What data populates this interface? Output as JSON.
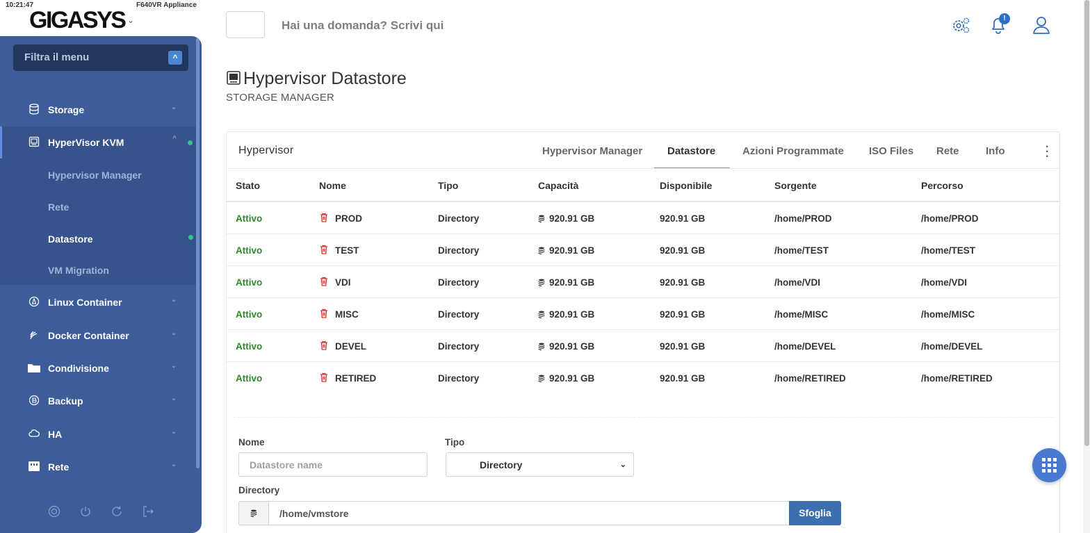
{
  "brand": {
    "clock": "10:21:47",
    "appliance": "F640VR Appliance",
    "logo_text": "GIGASYS"
  },
  "sidebar": {
    "filter_placeholder": "Filtra il menu",
    "items": [
      {
        "label": "Storage",
        "icon": "database-icon"
      },
      {
        "label": "HyperVisor KVM",
        "icon": "monitor-icon",
        "expanded": true
      },
      {
        "label": "Linux Container",
        "icon": "linux-icon"
      },
      {
        "label": "Docker Container",
        "icon": "docker-icon"
      },
      {
        "label": "Condivisione",
        "icon": "folder-icon"
      },
      {
        "label": "Backup",
        "icon": "backup-icon"
      },
      {
        "label": "HA",
        "icon": "cloud-icon"
      },
      {
        "label": "Rete",
        "icon": "network-icon"
      }
    ],
    "sub_items": [
      {
        "label": "Hypervisor Manager"
      },
      {
        "label": "Rete"
      },
      {
        "label": "Datastore",
        "active": true
      },
      {
        "label": "VM Migration"
      }
    ],
    "bottom_icons": [
      "lifebuoy-icon",
      "power-icon",
      "refresh-icon",
      "logout-icon"
    ]
  },
  "header": {
    "ask": "Hai una domanda? Scrivi qui",
    "notification_badge": "!"
  },
  "page": {
    "title": "Hypervisor Datastore",
    "subtitle": "STORAGE MANAGER"
  },
  "card": {
    "title": "Hypervisor",
    "tabs": [
      "Hypervisor Manager",
      "Datastore",
      "Azioni Programmate",
      "ISO Files",
      "Rete",
      "Info"
    ],
    "active_tab": "Datastore"
  },
  "table": {
    "headers": [
      "Stato",
      "Nome",
      "Tipo",
      "Capacità",
      "Disponibile",
      "Sorgente",
      "Percorso"
    ],
    "rows": [
      {
        "stato": "Attivo",
        "nome": "PROD",
        "tipo": "Directory",
        "capacita": "920.91 GB",
        "disponibile": "920.91 GB",
        "sorgente": "/home/PROD",
        "percorso": "/home/PROD"
      },
      {
        "stato": "Attivo",
        "nome": "TEST",
        "tipo": "Directory",
        "capacita": "920.91 GB",
        "disponibile": "920.91 GB",
        "sorgente": "/home/TEST",
        "percorso": "/home/TEST"
      },
      {
        "stato": "Attivo",
        "nome": "VDI",
        "tipo": "Directory",
        "capacita": "920.91 GB",
        "disponibile": "920.91 GB",
        "sorgente": "/home/VDI",
        "percorso": "/home/VDI"
      },
      {
        "stato": "Attivo",
        "nome": "MISC",
        "tipo": "Directory",
        "capacita": "920.91 GB",
        "disponibile": "920.91 GB",
        "sorgente": "/home/MISC",
        "percorso": "/home/MISC"
      },
      {
        "stato": "Attivo",
        "nome": "DEVEL",
        "tipo": "Directory",
        "capacita": "920.91 GB",
        "disponibile": "920.91 GB",
        "sorgente": "/home/DEVEL",
        "percorso": "/home/DEVEL"
      },
      {
        "stato": "Attivo",
        "nome": "RETIRED",
        "tipo": "Directory",
        "capacita": "920.91 GB",
        "disponibile": "920.91 GB",
        "sorgente": "/home/RETIRED",
        "percorso": "/home/RETIRED"
      }
    ]
  },
  "form": {
    "nome_label": "Nome",
    "nome_placeholder": "Datastore name",
    "tipo_label": "Tipo",
    "tipo_value": "Directory",
    "directory_label": "Directory",
    "directory_value": "/home/vmstore",
    "browse_label": "Sfoglia"
  },
  "colors": {
    "sidebar": "#3d5d99",
    "accent": "#3a6fb0",
    "status_active": "#2e8a28",
    "trash": "#d9312b",
    "online_dot": "#34c38f"
  }
}
